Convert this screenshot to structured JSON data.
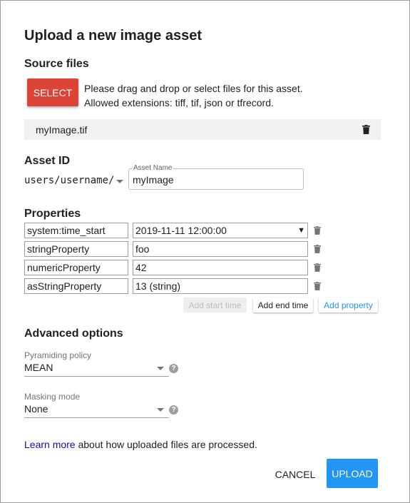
{
  "dialog": {
    "title": "Upload a new image asset"
  },
  "source_files": {
    "heading": "Source files",
    "select_label": "SELECT",
    "instructions_line1": "Please drag and drop or select files for this asset.",
    "instructions_line2": "Allowed extensions: tiff, tif, json or tfrecord.",
    "files": [
      {
        "name": "myImage.tif",
        "icon": "delete-icon"
      }
    ]
  },
  "asset_id": {
    "heading": "Asset ID",
    "prefix": "users/username/",
    "name_label": "Asset Name",
    "name_value": "myImage"
  },
  "properties": {
    "heading": "Properties",
    "rows": [
      {
        "key": "system:time_start",
        "value": "2019-11-11 12:00:00"
      },
      {
        "key": "stringProperty",
        "value": "foo"
      },
      {
        "key": "numericProperty",
        "value": "42"
      },
      {
        "key": "asStringProperty",
        "value": "13 (string)"
      }
    ],
    "add_start_time_label": "Add start time",
    "add_end_time_label": "Add end time",
    "add_property_label": "Add property"
  },
  "advanced": {
    "heading": "Advanced options",
    "pyramiding_label": "Pyramiding policy",
    "pyramiding_value": "MEAN",
    "masking_label": "Masking mode",
    "masking_value": "None"
  },
  "footer": {
    "learn_more_link": "Learn more",
    "learn_more_text": " about how uploaded files are processed.",
    "cancel_label": "CANCEL",
    "upload_label": "UPLOAD"
  },
  "colors": {
    "select_button": "#db4437",
    "upload_button": "#2196f3",
    "link": "#1a0dab",
    "add_property": "#2196f3"
  }
}
